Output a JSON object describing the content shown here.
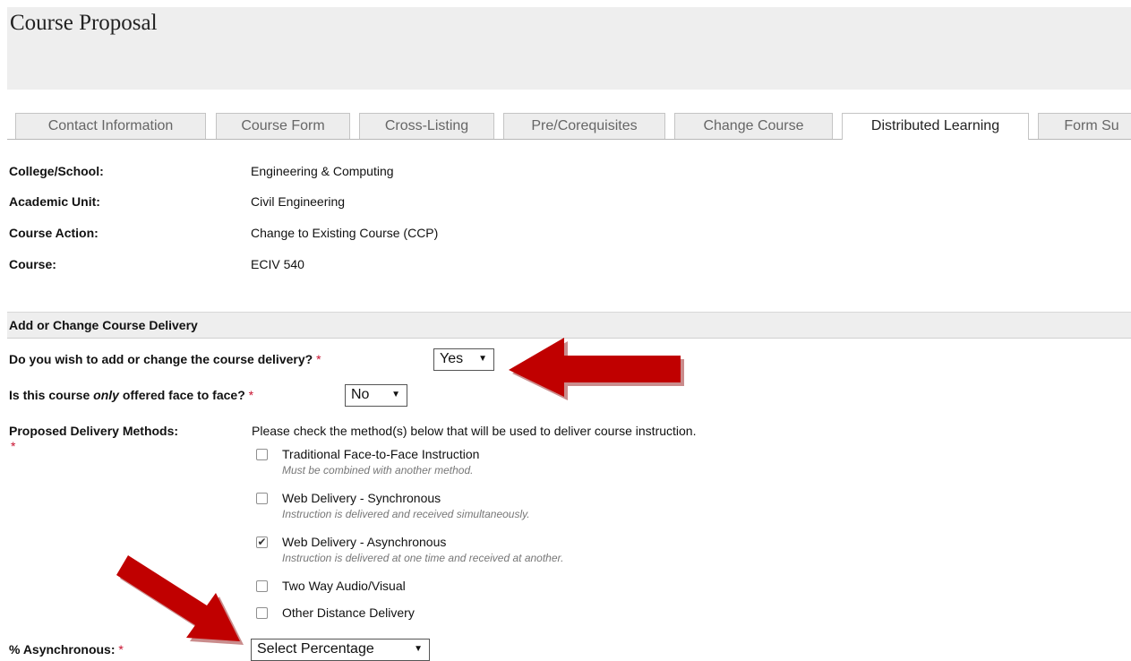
{
  "page": {
    "title": "Course Proposal"
  },
  "tabs": [
    {
      "label": "Contact Information",
      "active": false
    },
    {
      "label": "Course Form",
      "active": false
    },
    {
      "label": "Cross-Listing",
      "active": false
    },
    {
      "label": "Pre/Corequisites",
      "active": false
    },
    {
      "label": "Change Course",
      "active": false
    },
    {
      "label": "Distributed Learning",
      "active": true
    },
    {
      "label": "Form Su",
      "active": false
    }
  ],
  "info": [
    {
      "label": "College/School:",
      "value": "Engineering & Computing"
    },
    {
      "label": "Academic Unit:",
      "value": "Civil Engineering"
    },
    {
      "label": "Course Action:",
      "value": "Change to Existing Course (CCP)"
    },
    {
      "label": "Course:",
      "value": "ECIV 540"
    }
  ],
  "section": {
    "title": "Add or Change Course Delivery"
  },
  "questions": {
    "add_change": {
      "label": "Do you wish to add or change the course delivery?",
      "required_mark": "*",
      "value": "Yes"
    },
    "face_to_face": {
      "label_pre": "Is this course ",
      "label_em": "only",
      "label_post": " offered face to face?",
      "required_mark": "*",
      "value": "No"
    },
    "methods": {
      "label": "Proposed Delivery Methods:",
      "required_mark": "*",
      "intro": "Please check the method(s) below that will be used to deliver course instruction.",
      "options": [
        {
          "label": "Traditional Face-to-Face Instruction",
          "help": "Must be combined with another method.",
          "checked": false
        },
        {
          "label": "Web Delivery - Synchronous",
          "help": "Instruction is delivered and received simultaneously.",
          "checked": false
        },
        {
          "label": "Web Delivery - Asynchronous",
          "help": "Instruction is delivered at one time and received at another.",
          "checked": true
        },
        {
          "label": "Two Way Audio/Visual",
          "help": "",
          "checked": false
        },
        {
          "label": "Other Distance Delivery",
          "help": "",
          "checked": false
        }
      ]
    },
    "asynchronous_pct": {
      "label": "% Asynchronous:",
      "required_mark": "*",
      "value": "Select Percentage"
    }
  },
  "colors": {
    "required": "#c8102e",
    "annotation_arrow": "#c00000",
    "header_band": "#eeeeee"
  },
  "glyphs": {
    "select_arrow": "▼",
    "check_mark": "✔"
  }
}
